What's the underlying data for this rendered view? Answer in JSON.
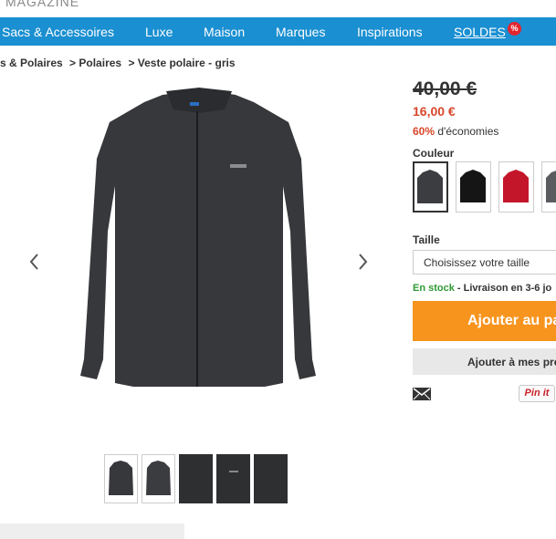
{
  "header": {
    "magazine_label": "MAGAZINE"
  },
  "nav": {
    "items": [
      "Sacs & Accessoires",
      "Luxe",
      "Maison",
      "Marques",
      "Inspirations",
      "SOLDES"
    ],
    "sale_badge": "%"
  },
  "breadcrumb": [
    "s & Polaires",
    "> Polaires",
    "> Veste polaire - gris"
  ],
  "product": {
    "old_price": "40,00 €",
    "new_price": "16,00 €",
    "savings_pct": "60%",
    "savings_text": "d'économies",
    "color_label": "Couleur",
    "colors": [
      "grey",
      "black",
      "red",
      "dark-grey"
    ],
    "size_label": "Taille",
    "size_placeholder": "Choisissez votre taille",
    "stock_status": "En stock",
    "delivery_text": " - Livraison en 3-6 jo",
    "add_to_cart": "Ajouter au pa",
    "add_to_wishlist": "Ajouter à mes pré",
    "pinit_label": "Pin it"
  },
  "colors": {
    "nav_bg": "#1a8fd1",
    "price_red": "#d7462a",
    "cta_orange": "#f7941e",
    "stock_green": "#2f9a33"
  }
}
